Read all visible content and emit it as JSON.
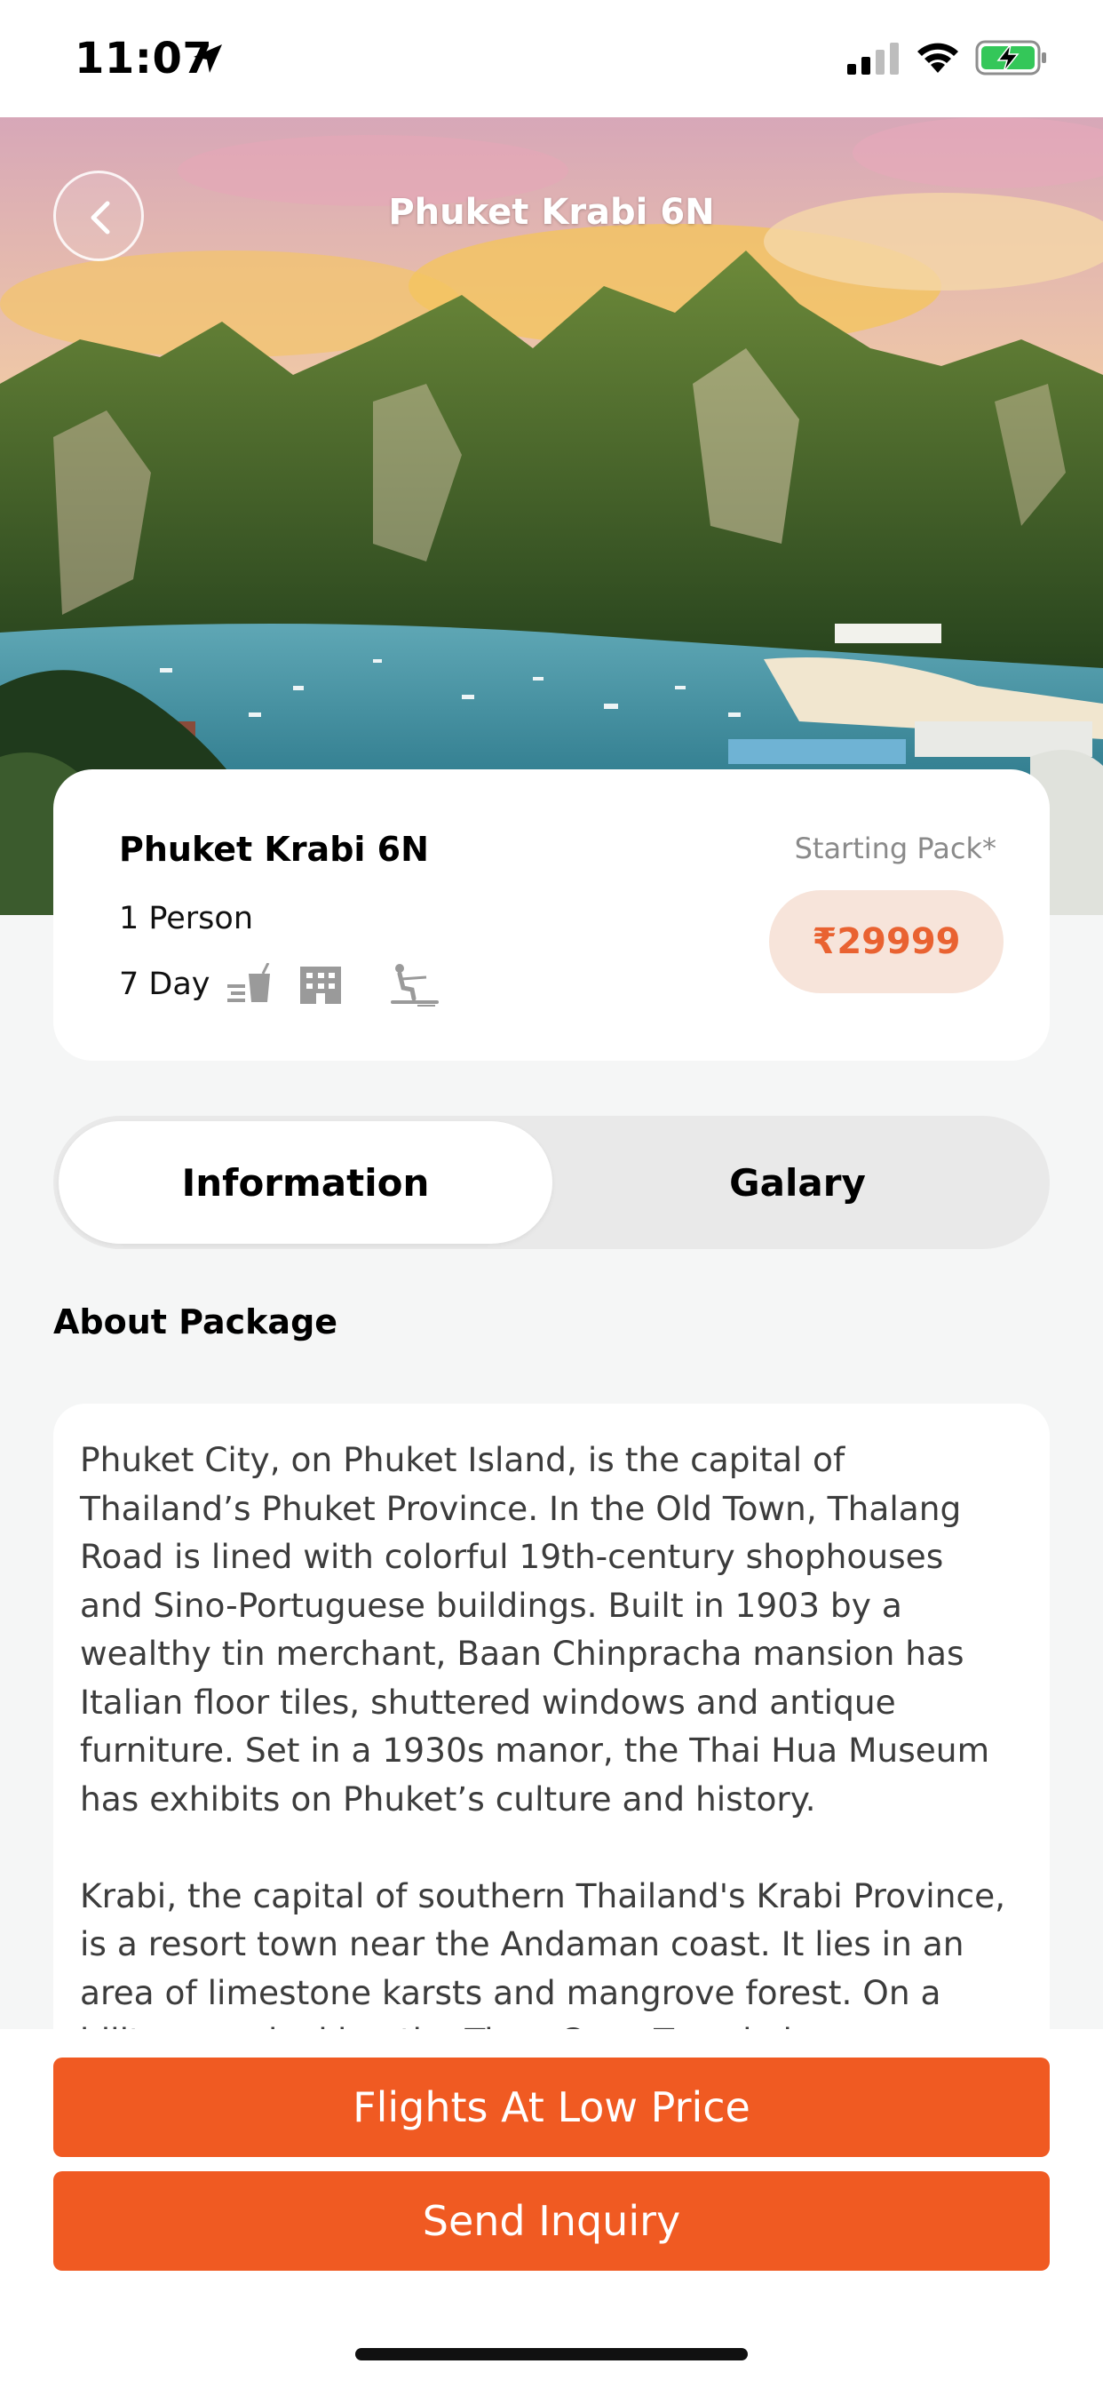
{
  "status_bar": {
    "time": "11:07",
    "icons": [
      "location-arrow-icon",
      "cellular-signal-icon",
      "wifi-icon",
      "battery-charging-icon"
    ]
  },
  "header": {
    "title": "Phuket Krabi 6N",
    "back_icon": "chevron-left-icon"
  },
  "package": {
    "name": "Phuket Krabi 6N",
    "persons": "1 Person",
    "duration": "7 Day",
    "amenities": [
      "drink-icon",
      "hotel-icon",
      "water-ski-icon"
    ],
    "starting_label": "Starting Pack*",
    "price": "₹29999"
  },
  "tabs": [
    {
      "label": "Information",
      "active": true
    },
    {
      "label": "Galary",
      "active": false
    }
  ],
  "about": {
    "heading": "About Package",
    "text": "Phuket City, on Phuket Island, is the capital of\nThailand’s Phuket Province. In the Old Town, Thalang\nRoad is lined with colorful 19th-century shophouses\nand Sino-Portuguese buildings. Built in 1903 by a\nwealthy tin merchant, Baan Chinpracha mansion has\nItalian floor tiles, shuttered windows and antique\nfurniture. Set in a 1930s manor, the Thai Hua Museum\nhas exhibits on Phuket’s culture and history.\n\nKrabi, the capital of southern Thailand's Krabi Province,\nis a resort town near the Andaman coast. It lies in an\narea of limestone karsts and mangrove forest. On a\nhilltop overlooking the Tiger Cave Temple is"
  },
  "actions": {
    "flights_label": "Flights At Low Price",
    "inquiry_label": "Send Inquiry"
  },
  "colors": {
    "accent": "#f05a22",
    "price_text": "#e96231",
    "price_bg": "#f7e4da",
    "background": "#f5f6f6"
  }
}
